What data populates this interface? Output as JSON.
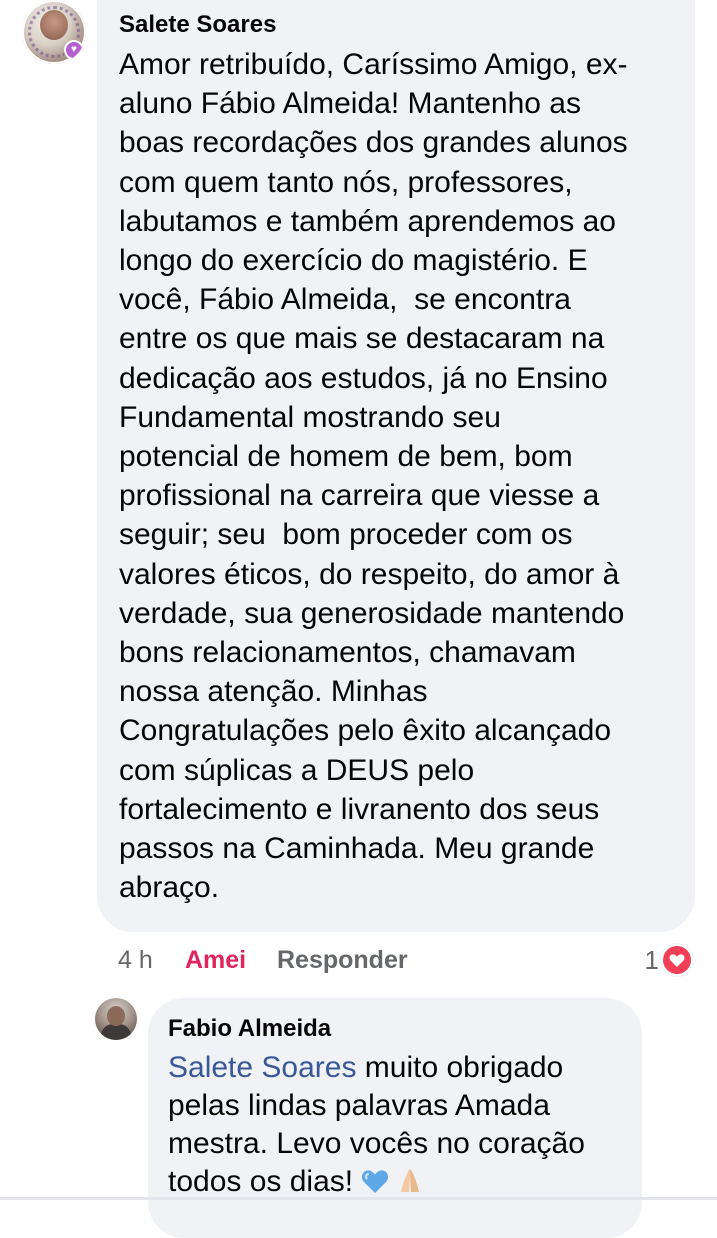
{
  "comment": {
    "author": "Salete Soares",
    "text": "Amor retribuído, Caríssimo Amigo, ex-aluno Fábio Almeida! Mantenho as boas recordações dos grandes alunos com quem tanto nós, professores, labutamos e também aprendemos ao longo do exercício do magistério. E você, Fábio Almeida,  se encontra entre os que mais se destacaram na dedicação aos estudos, já no Ensino Fundamental mostrando seu potencial de homem de bem, bom profissional na carreira que viesse a seguir; seu  bom proceder com os valores éticos, do respeito, do amor à verdade, sua generosidade mantendo bons relacionamentos, chamavam nossa atenção. Minhas Congratulações pelo êxito alcançado com súplicas a DEUS pelo fortalecimento e livranento dos seus passos na Caminhada. Meu grande abraço.",
    "lines": [
      "Amor retribuído, Caríssimo Amigo, ex-",
      "aluno Fábio Almeida! Mantenho as",
      "boas recordações dos grandes alunos",
      "com quem tanto nós, professores,",
      "labutamos e também aprendemos ao",
      "longo do exercício do magistério. E",
      "você, Fábio Almeida,  se encontra",
      "entre os que mais se destacaram na",
      "dedicação aos estudos, já no Ensino",
      "Fundamental mostrando seu",
      "potencial de homem de bem, bom",
      "profissional na carreira que viesse a",
      "seguir; seu  bom proceder com os",
      "valores éticos, do respeito, do amor à",
      "verdade, sua generosidade mantendo",
      "bons relacionamentos, chamavam",
      "nossa atenção. Minhas",
      "Congratulações pelo êxito alcançado",
      "com súplicas a DEUS pelo",
      "fortalecimento e livranento dos seus",
      "passos na Caminhada. Meu grande",
      "abraço."
    ],
    "time": "4 h",
    "reaction_label": "Amei",
    "reply_label": "Responder",
    "reaction_count": "1",
    "reaction_icon": "heart-icon",
    "reaction_color": "#f33e58",
    "reacted_label_color": "#e0245e"
  },
  "reply": {
    "author": "Fabio Almeida",
    "mention": "Salete Soares",
    "text_after_mention": " muito obrigado pelas lindas palavras Amada mestra. Levo vocês no coração todos os dias!",
    "emojis": [
      "blue-heart-icon",
      "folded-hands-icon"
    ],
    "mention_color": "#385898"
  },
  "colors": {
    "bubble_bg": "#f0f2f5",
    "text": "#050505",
    "muted": "#65676b"
  }
}
